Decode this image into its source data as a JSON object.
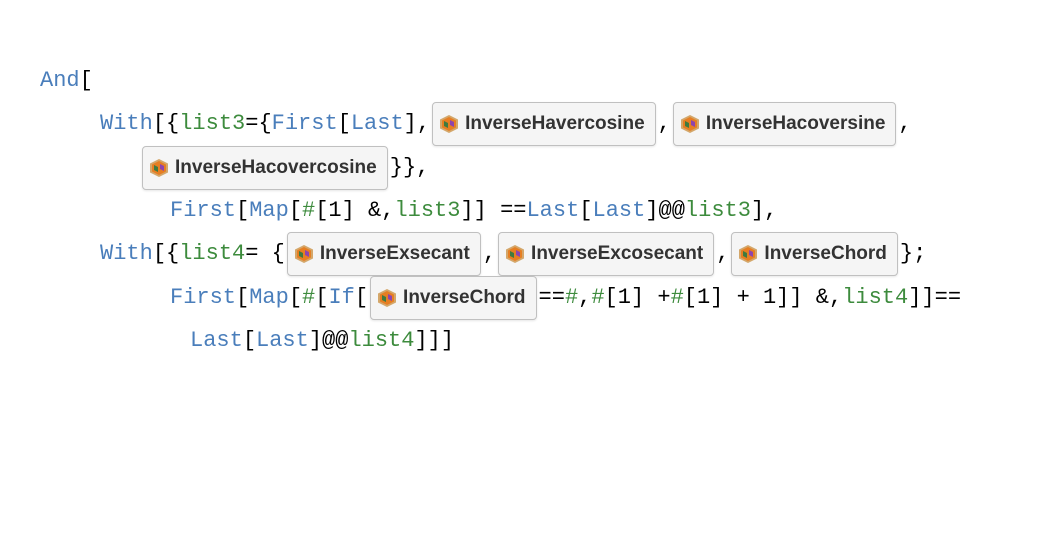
{
  "code": {
    "kw_And": "And",
    "kw_With": "With",
    "kw_First": "First",
    "kw_Last": "Last",
    "kw_Map": "Map",
    "kw_If": "If",
    "var_list3": "list3",
    "var_list4": "list4",
    "slot": "#",
    "punct": {
      "lbracket": "[",
      "rbracket": "]",
      "lbrace": "{",
      "rbrace": "}",
      "comma": ", ",
      "comma_nosp": ",",
      "equals": " = ",
      "semicolon": ";",
      "eqeq": " == ",
      "amp": " & ",
      "amp_comma": " &, ",
      "amp_list4": " & /@ ",
      "amp_semicolon": " &;",
      "atat": " @@ "
    },
    "resources": {
      "invHavercosine": "InverseHavercosine",
      "invHacoversine": "InverseHacoversine",
      "invHacovercosine": "InverseHacovercosine",
      "invExsecant": "InverseExsecant",
      "invExcosecant": "InverseExcosecant",
      "invChord": "InverseChord"
    },
    "line3_suffix": "};",
    "line4_text": "[1] &, ",
    "line4_suffix": "]] == ",
    "line5_text": " = {",
    "line5_suffix": "};",
    "line6_text": "[1] + ",
    "line6_suffix": "[1] + 1]] &, ",
    "line7_text": "]]]"
  }
}
